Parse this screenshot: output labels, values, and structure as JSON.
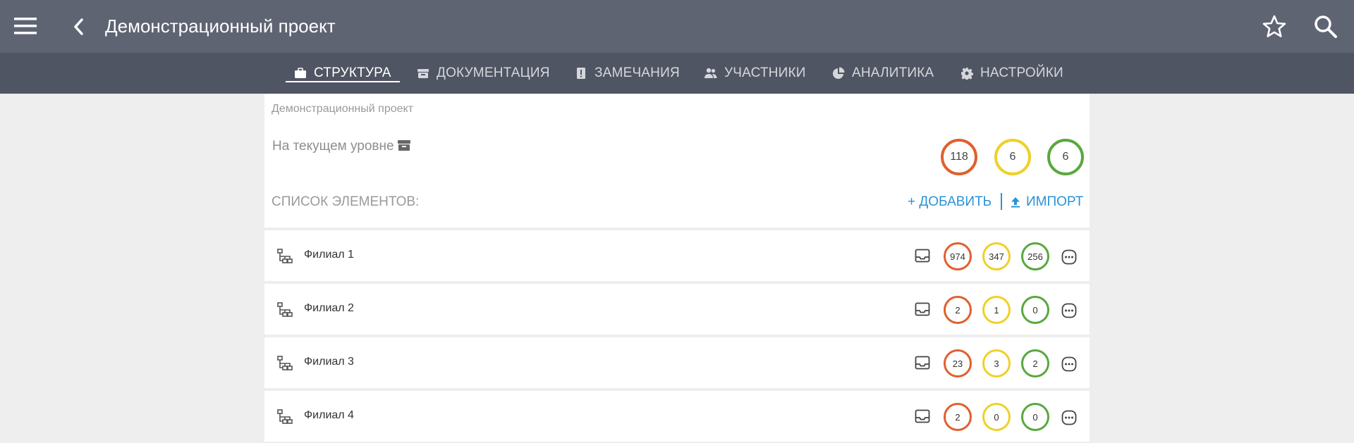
{
  "header": {
    "title": "Демонстрационный проект",
    "menu_icon": "menu-icon",
    "back_icon": "chevron-left-icon",
    "star_icon": "star-icon",
    "search_icon": "search-icon"
  },
  "tabs": [
    {
      "label": "СТРУКТУРА",
      "icon": "briefcase-icon",
      "active": true
    },
    {
      "label": "ДОКУМЕНТАЦИЯ",
      "icon": "archive-icon",
      "active": false
    },
    {
      "label": "ЗАМЕЧАНИЯ",
      "icon": "alert-icon",
      "active": false
    },
    {
      "label": "УЧАСТНИКИ",
      "icon": "people-icon",
      "active": false
    },
    {
      "label": "АНАЛИТИКА",
      "icon": "pie-chart-icon",
      "active": false
    },
    {
      "label": "НАСТРОЙКИ",
      "icon": "gear-icon",
      "active": false
    }
  ],
  "panel": {
    "breadcrumb": "Демонстрационный проект",
    "level_label": "На текущем уровне",
    "counts": {
      "red": "118",
      "yellow": "6",
      "green": "6"
    },
    "list_label": "СПИСОК ЭЛЕМЕНТОВ:",
    "add_label": "+ ДОБАВИТЬ",
    "import_label": "ИМПОРТ"
  },
  "colors": {
    "red": "#e0602e",
    "yellow": "#f0d028",
    "green": "#58a83e",
    "accent": "#2a92d6",
    "header_bg": "#5f6473",
    "tabbar_bg": "#505563"
  },
  "rows": [
    {
      "name": "Филиал 1",
      "red": "974",
      "yellow": "347",
      "green": "256"
    },
    {
      "name": "Филиал 2",
      "red": "2",
      "yellow": "1",
      "green": "0"
    },
    {
      "name": "Филиал 3",
      "red": "23",
      "yellow": "3",
      "green": "2"
    },
    {
      "name": "Филиал 4",
      "red": "2",
      "yellow": "0",
      "green": "0"
    }
  ]
}
